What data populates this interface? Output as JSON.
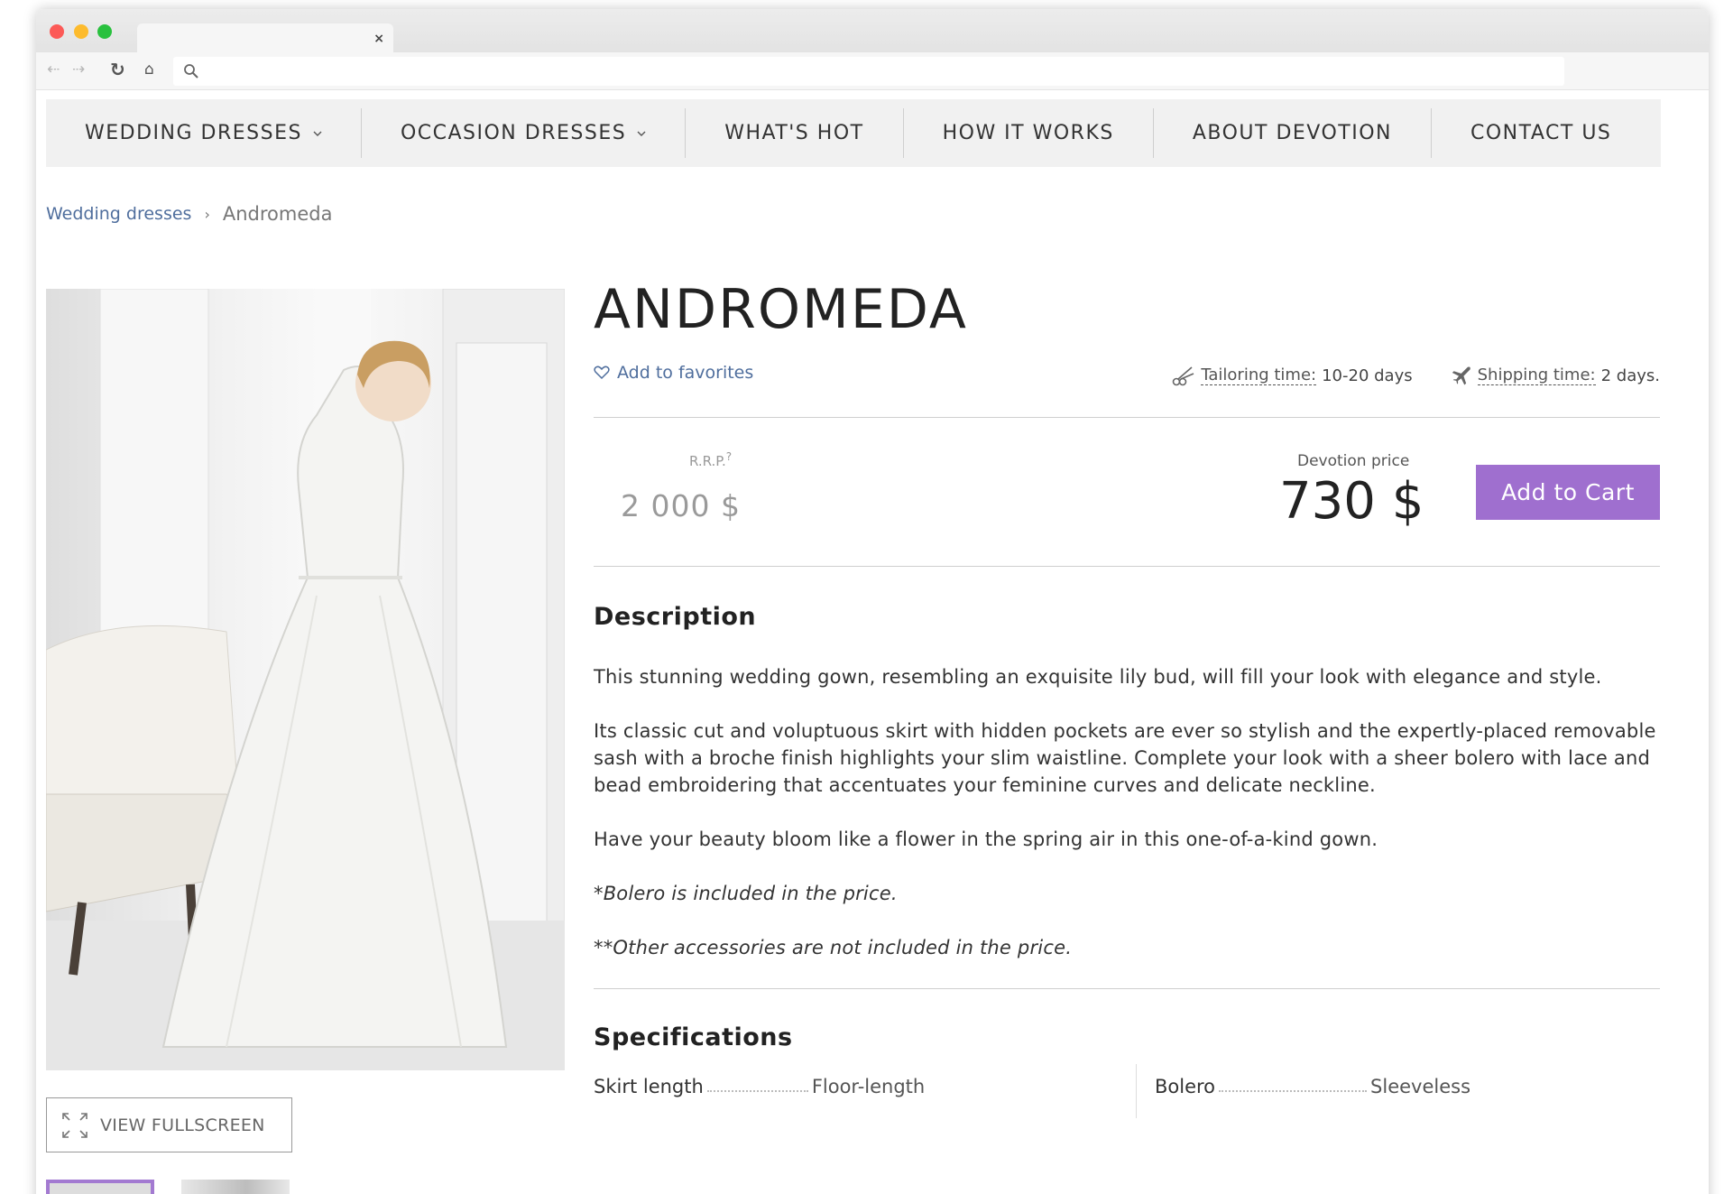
{
  "browser": {
    "tab_close": "×",
    "icons": {
      "back": "left-arrow-icon",
      "forward": "right-arrow-icon",
      "reload": "reload-icon",
      "home": "home-icon",
      "search": "search-icon"
    }
  },
  "menu": [
    {
      "label": "WEDDING DRESSES",
      "dropdown": true
    },
    {
      "label": "OCCASION DRESSES",
      "dropdown": true
    },
    {
      "label": "WHAT'S HOT",
      "dropdown": false
    },
    {
      "label": "HOW IT WORKS",
      "dropdown": false
    },
    {
      "label": "ABOUT DEVOTION",
      "dropdown": false
    },
    {
      "label": "CONTACT US",
      "dropdown": false
    }
  ],
  "breadcrumb": {
    "parent": "Wedding dresses",
    "separator": "›",
    "current": "Andromeda"
  },
  "product": {
    "title": "ANDROMEDA",
    "favorites_label": "Add to favorites",
    "tailoring_label": "Tailoring time:",
    "tailoring_value": "10-20 days",
    "shipping_label": "Shipping time:",
    "shipping_value": "2 days.",
    "rrp_label": "R.R.P.",
    "rrp_mark": "?",
    "rrp_value": "2 000 $",
    "devotion_label": "Devotion price",
    "devotion_value": "730 $",
    "cart_button": "Add to Cart"
  },
  "description": {
    "title": "Description",
    "paragraphs": [
      "This stunning wedding gown, resembling an exquisite lily bud, will fill your look with elegance and style.",
      "Its classic cut and voluptuous skirt with hidden pockets are ever so stylish and the expertly-placed removable sash with a broche finish highlights your slim waistline. Complete your look with a sheer bolero with lace and bead embroidering that accentuates your feminine curves and delicate neckline.",
      "Have your beauty bloom like a flower in the spring air in this one-of-a-kind gown.",
      "*Bolero is included in the price.",
      "**Other accessories are not included in the price."
    ]
  },
  "specifications": {
    "title": "Specifications",
    "items": [
      {
        "key": "Skirt length",
        "value": "Floor-length"
      },
      {
        "key": "Bolero",
        "value": "Sleeveless"
      }
    ]
  },
  "gallery": {
    "fullscreen_label": "VIEW FULLSCREEN"
  },
  "colors": {
    "accent": "#9f6fcf",
    "link": "#4f6e9d",
    "menu_bg": "#f1f1f1"
  }
}
